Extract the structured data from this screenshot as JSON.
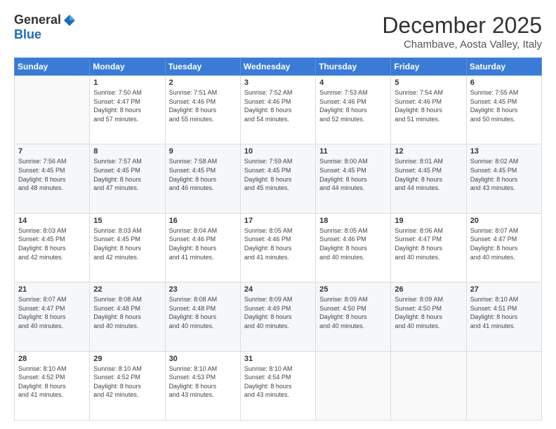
{
  "logo": {
    "general": "General",
    "blue": "Blue"
  },
  "title": "December 2025",
  "location": "Chambave, Aosta Valley, Italy",
  "weekdays": [
    "Sunday",
    "Monday",
    "Tuesday",
    "Wednesday",
    "Thursday",
    "Friday",
    "Saturday"
  ],
  "weeks": [
    [
      {
        "day": "",
        "info": ""
      },
      {
        "day": "1",
        "info": "Sunrise: 7:50 AM\nSunset: 4:47 PM\nDaylight: 8 hours\nand 57 minutes."
      },
      {
        "day": "2",
        "info": "Sunrise: 7:51 AM\nSunset: 4:46 PM\nDaylight: 8 hours\nand 55 minutes."
      },
      {
        "day": "3",
        "info": "Sunrise: 7:52 AM\nSunset: 4:46 PM\nDaylight: 8 hours\nand 54 minutes."
      },
      {
        "day": "4",
        "info": "Sunrise: 7:53 AM\nSunset: 4:46 PM\nDaylight: 8 hours\nand 52 minutes."
      },
      {
        "day": "5",
        "info": "Sunrise: 7:54 AM\nSunset: 4:46 PM\nDaylight: 8 hours\nand 51 minutes."
      },
      {
        "day": "6",
        "info": "Sunrise: 7:55 AM\nSunset: 4:45 PM\nDaylight: 8 hours\nand 50 minutes."
      }
    ],
    [
      {
        "day": "7",
        "info": "Sunrise: 7:56 AM\nSunset: 4:45 PM\nDaylight: 8 hours\nand 48 minutes."
      },
      {
        "day": "8",
        "info": "Sunrise: 7:57 AM\nSunset: 4:45 PM\nDaylight: 8 hours\nand 47 minutes."
      },
      {
        "day": "9",
        "info": "Sunrise: 7:58 AM\nSunset: 4:45 PM\nDaylight: 8 hours\nand 46 minutes."
      },
      {
        "day": "10",
        "info": "Sunrise: 7:59 AM\nSunset: 4:45 PM\nDaylight: 8 hours\nand 45 minutes."
      },
      {
        "day": "11",
        "info": "Sunrise: 8:00 AM\nSunset: 4:45 PM\nDaylight: 8 hours\nand 44 minutes."
      },
      {
        "day": "12",
        "info": "Sunrise: 8:01 AM\nSunset: 4:45 PM\nDaylight: 8 hours\nand 44 minutes."
      },
      {
        "day": "13",
        "info": "Sunrise: 8:02 AM\nSunset: 4:45 PM\nDaylight: 8 hours\nand 43 minutes."
      }
    ],
    [
      {
        "day": "14",
        "info": "Sunrise: 8:03 AM\nSunset: 4:45 PM\nDaylight: 8 hours\nand 42 minutes."
      },
      {
        "day": "15",
        "info": "Sunrise: 8:03 AM\nSunset: 4:45 PM\nDaylight: 8 hours\nand 42 minutes."
      },
      {
        "day": "16",
        "info": "Sunrise: 8:04 AM\nSunset: 4:46 PM\nDaylight: 8 hours\nand 41 minutes."
      },
      {
        "day": "17",
        "info": "Sunrise: 8:05 AM\nSunset: 4:46 PM\nDaylight: 8 hours\nand 41 minutes."
      },
      {
        "day": "18",
        "info": "Sunrise: 8:05 AM\nSunset: 4:46 PM\nDaylight: 8 hours\nand 40 minutes."
      },
      {
        "day": "19",
        "info": "Sunrise: 8:06 AM\nSunset: 4:47 PM\nDaylight: 8 hours\nand 40 minutes."
      },
      {
        "day": "20",
        "info": "Sunrise: 8:07 AM\nSunset: 4:47 PM\nDaylight: 8 hours\nand 40 minutes."
      }
    ],
    [
      {
        "day": "21",
        "info": "Sunrise: 8:07 AM\nSunset: 4:47 PM\nDaylight: 8 hours\nand 40 minutes."
      },
      {
        "day": "22",
        "info": "Sunrise: 8:08 AM\nSunset: 4:48 PM\nDaylight: 8 hours\nand 40 minutes."
      },
      {
        "day": "23",
        "info": "Sunrise: 8:08 AM\nSunset: 4:48 PM\nDaylight: 8 hours\nand 40 minutes."
      },
      {
        "day": "24",
        "info": "Sunrise: 8:09 AM\nSunset: 4:49 PM\nDaylight: 8 hours\nand 40 minutes."
      },
      {
        "day": "25",
        "info": "Sunrise: 8:09 AM\nSunset: 4:50 PM\nDaylight: 8 hours\nand 40 minutes."
      },
      {
        "day": "26",
        "info": "Sunrise: 8:09 AM\nSunset: 4:50 PM\nDaylight: 8 hours\nand 40 minutes."
      },
      {
        "day": "27",
        "info": "Sunrise: 8:10 AM\nSunset: 4:51 PM\nDaylight: 8 hours\nand 41 minutes."
      }
    ],
    [
      {
        "day": "28",
        "info": "Sunrise: 8:10 AM\nSunset: 4:52 PM\nDaylight: 8 hours\nand 41 minutes."
      },
      {
        "day": "29",
        "info": "Sunrise: 8:10 AM\nSunset: 4:52 PM\nDaylight: 8 hours\nand 42 minutes."
      },
      {
        "day": "30",
        "info": "Sunrise: 8:10 AM\nSunset: 4:53 PM\nDaylight: 8 hours\nand 43 minutes."
      },
      {
        "day": "31",
        "info": "Sunrise: 8:10 AM\nSunset: 4:54 PM\nDaylight: 8 hours\nand 43 minutes."
      },
      {
        "day": "",
        "info": ""
      },
      {
        "day": "",
        "info": ""
      },
      {
        "day": "",
        "info": ""
      }
    ]
  ]
}
